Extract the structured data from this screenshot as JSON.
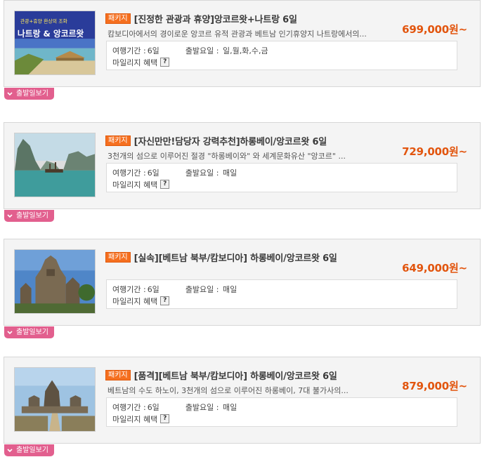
{
  "packages": [
    {
      "badge": "패키지",
      "title": "[진정한 관광과 휴양]앙코르왓+나트랑 6일",
      "price": "699,000원~",
      "description": "캄보디아에서의 경이로운 앙코르 유적 관광과 베트남 인기휴양지 나트랑에서의...",
      "duration_label": "여행기간 : ",
      "duration": "6일",
      "departure_label": "출발요일 : ",
      "departure": "일,월,화,수,금",
      "mileage_label": "마일리지 혜택",
      "help_icon_text": "?",
      "departure_button": "출발일보기",
      "thumb_top_text": "관광+휴양  환상의 조화",
      "thumb_main_text": "나트랑 & 앙코르왓"
    },
    {
      "badge": "패키지",
      "title": "[자신만만!담당자 강력추천]하롱베이/앙코르왓 6일",
      "price": "729,000원~",
      "description": "3천개의 섬으로 이루어진 절경 \"하롱베이와\" 와 세계문화유산 \"앙코르\" ...",
      "duration_label": "여행기간 : ",
      "duration": "6일",
      "departure_label": "출발요일 : ",
      "departure": "매일",
      "mileage_label": "마일리지 혜택",
      "help_icon_text": "?",
      "departure_button": "출발일보기"
    },
    {
      "badge": "패키지",
      "title": "[실속][베트남 북부/캄보디아] 하롱베이/앙코르왓 6일",
      "price": "649,000원~",
      "description": "",
      "duration_label": "여행기간 : ",
      "duration": "6일",
      "departure_label": "출발요일 : ",
      "departure": "매일",
      "mileage_label": "마일리지 혜택",
      "help_icon_text": "?",
      "departure_button": "출발일보기"
    },
    {
      "badge": "패키지",
      "title": "[품격][베트남 북부/캄보디아] 하롱베이/앙코르왓 6일",
      "price": "879,000원~",
      "description": "베트남의 수도 하노이, 3천개의 섬으로 이루어진 하롱베이, 7대 불가사의...",
      "duration_label": "여행기간 : ",
      "duration": "6일",
      "departure_label": "출발요일 : ",
      "departure": "매일",
      "mileage_label": "마일리지 혜택",
      "help_icon_text": "?",
      "departure_button": "출발일보기"
    }
  ],
  "colors": {
    "badge": "#f56f1f",
    "price": "#e2550e",
    "departure_button": "#e25f8e"
  },
  "icons": [
    "help-icon",
    "chevron-down-icon"
  ]
}
